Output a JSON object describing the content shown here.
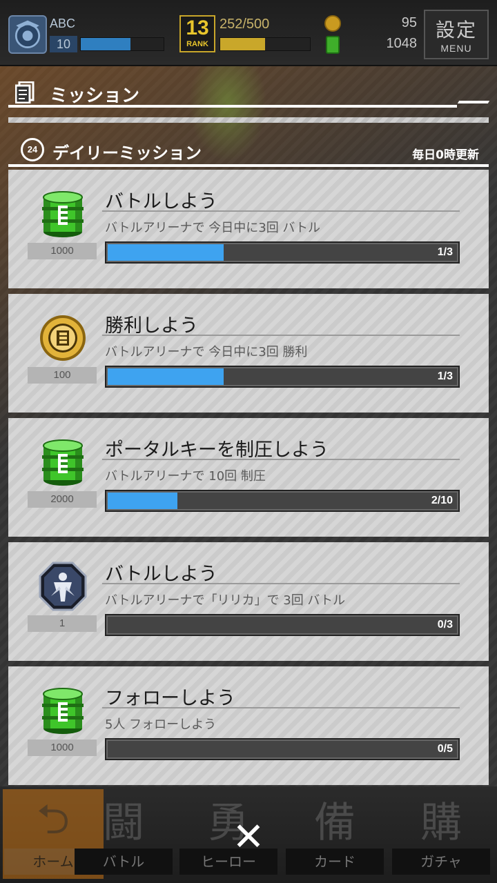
{
  "header": {
    "player_name": "ABC",
    "player_level": "10",
    "level_progress": 0.6,
    "rank_badge_big": "13",
    "rank_badge_small": "RANK",
    "rank_value": "252/500",
    "rank_progress": 0.5,
    "coins": "95",
    "drums": "1048",
    "menu_kanji": "設定",
    "menu_en": "MENU"
  },
  "section": {
    "title": "ミッション"
  },
  "daily": {
    "clock_label": "24",
    "title": "デイリーミッション",
    "reset_note": "毎日0時更新"
  },
  "missions": [
    {
      "reward_icon": "green-drum-icon",
      "reward_count": "1000",
      "title": "バトルしよう",
      "description": "バトルアリーナで 今日中に3回 バトル",
      "progress_text": "1/3",
      "progress": 0.333
    },
    {
      "reward_icon": "gold-coin-icon",
      "reward_count": "100",
      "title": "勝利しよう",
      "description": "バトルアリーナで 今日中に3回 勝利",
      "progress_text": "1/3",
      "progress": 0.333
    },
    {
      "reward_icon": "green-drum-icon",
      "reward_count": "2000",
      "title": "ポータルキーを制圧しよう",
      "description": "バトルアリーナで 10回 制圧",
      "progress_text": "2/10",
      "progress": 0.2
    },
    {
      "reward_icon": "hero-emblem-icon",
      "reward_count": "1",
      "title": "バトルしよう",
      "description": "バトルアリーナで「リリカ」で 3回 バトル",
      "progress_text": "0/3",
      "progress": 0
    },
    {
      "reward_icon": "green-drum-icon",
      "reward_count": "1000",
      "title": "フォローしよう",
      "description": "5人 フォローしよう",
      "progress_text": "0/5",
      "progress": 0
    }
  ],
  "nav": {
    "home": "ホーム",
    "battle": "バトル",
    "battle_glyph": "闘",
    "hero": "ヒーロー",
    "hero_glyph": "勇",
    "card": "カード",
    "card_glyph": "備",
    "gacha": "ガチャ",
    "gacha_glyph": "購"
  },
  "close_glyph": "✕",
  "colors": {
    "progress_fill": "#3ea3f0",
    "card_bg": "#d6d6d6",
    "home_accent": "#d77b14"
  }
}
